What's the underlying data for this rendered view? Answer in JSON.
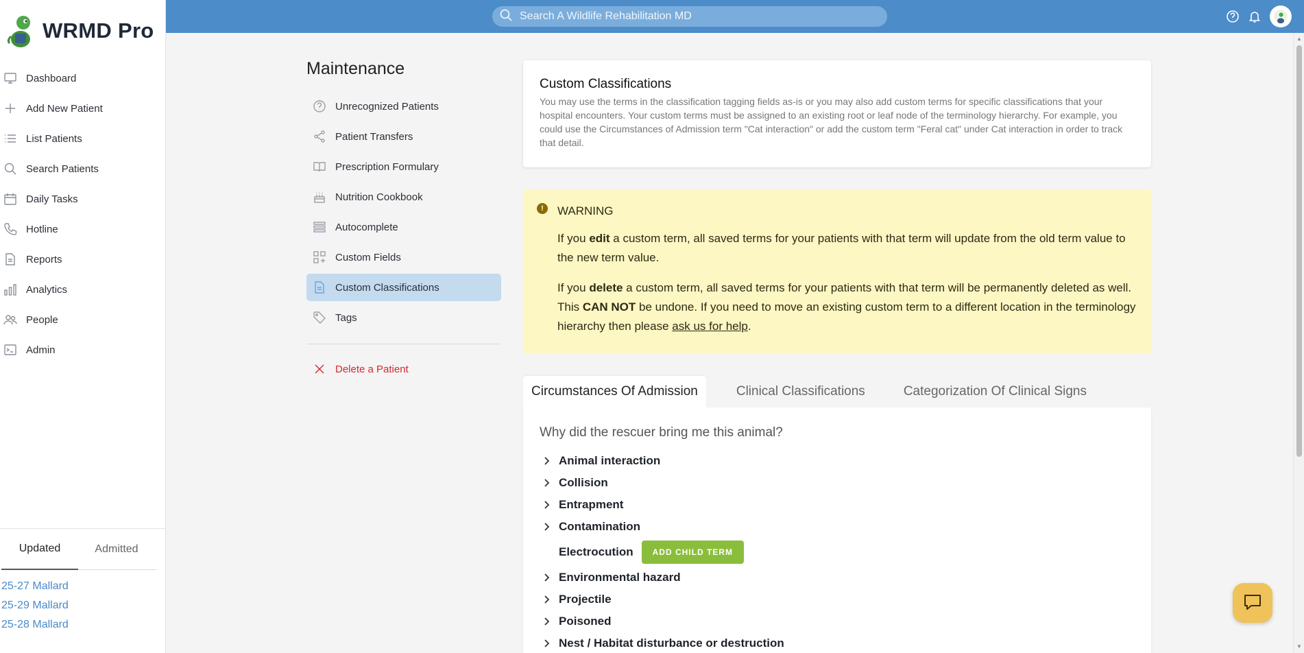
{
  "app": {
    "title": "WRMD Pro"
  },
  "nav": [
    {
      "label": "Dashboard",
      "icon": "monitor-icon"
    },
    {
      "label": "Add New Patient",
      "icon": "plus-icon"
    },
    {
      "label": "List Patients",
      "icon": "list-icon"
    },
    {
      "label": "Search Patients",
      "icon": "search-icon"
    },
    {
      "label": "Daily Tasks",
      "icon": "calendar-icon"
    },
    {
      "label": "Hotline",
      "icon": "phone-icon"
    },
    {
      "label": "Reports",
      "icon": "document-icon"
    },
    {
      "label": "Analytics",
      "icon": "bar-chart-icon"
    },
    {
      "label": "People",
      "icon": "people-icon"
    },
    {
      "label": "Admin",
      "icon": "terminal-icon"
    }
  ],
  "recent": {
    "tabs": [
      "Updated",
      "Admitted"
    ],
    "active_tab": "Updated",
    "items": [
      "25-27 Mallard",
      "25-29 Mallard",
      "25-28 Mallard"
    ]
  },
  "topbar": {
    "search_placeholder": "Search A Wildlife Rehabilitation MD",
    "icons": [
      "help-icon",
      "bell-icon",
      "user-avatar"
    ]
  },
  "maintenance": {
    "title": "Maintenance",
    "items": [
      {
        "label": "Unrecognized Patients",
        "icon": "question-icon"
      },
      {
        "label": "Patient Transfers",
        "icon": "share-icon"
      },
      {
        "label": "Prescription Formulary",
        "icon": "book-icon"
      },
      {
        "label": "Nutrition Cookbook",
        "icon": "cake-icon"
      },
      {
        "label": "Autocomplete",
        "icon": "stack-icon"
      },
      {
        "label": "Custom Fields",
        "icon": "grid-plus-icon"
      },
      {
        "label": "Custom Classifications",
        "icon": "file-icon",
        "active": true
      },
      {
        "label": "Tags",
        "icon": "tag-icon"
      }
    ],
    "danger_item": {
      "label": "Delete a Patient",
      "icon": "x-icon"
    }
  },
  "intro": {
    "title": "Custom Classifications",
    "body": "You may use the terms in the classification tagging fields as-is or you may also add custom terms for specific classifications that your hospital encounters. Your custom terms must be assigned to an existing root or leaf node of the terminology hierarchy. For example, you could use the Circumstances of Admission term \"Cat interaction\" or add the custom term \"Feral cat\" under Cat interaction in order to track that detail."
  },
  "warning": {
    "title": "WARNING",
    "p1_pre": "If you ",
    "p1_bold": "edit",
    "p1_post": " a custom term, all saved terms for your patients with that term will update from the old term value to the new term value.",
    "p2_pre": "If you ",
    "p2_bold": "delete",
    "p2_mid": " a custom term, all saved terms for your patients with that term will be permanently deleted as well. This ",
    "p2_bold2": "CAN NOT",
    "p2_post": " be undone. If you need to move an existing custom term to a different location in the terminology hierarchy then please ",
    "p2_link": "ask us for help",
    "p2_end": "."
  },
  "tabs": {
    "items": [
      "Circumstances Of Admission",
      "Clinical Classifications",
      "Categorization Of Clinical Signs"
    ],
    "active": 0
  },
  "tree": {
    "question": "Why did the rescuer bring me this animal?",
    "nodes": [
      {
        "label": "Animal interaction",
        "expandable": true
      },
      {
        "label": "Collision",
        "expandable": true
      },
      {
        "label": "Entrapment",
        "expandable": true
      },
      {
        "label": "Contamination",
        "expandable": true
      },
      {
        "label": "Electrocution",
        "expandable": false,
        "action": "ADD CHILD TERM"
      },
      {
        "label": "Environmental hazard",
        "expandable": true
      },
      {
        "label": "Projectile",
        "expandable": true
      },
      {
        "label": "Poisoned",
        "expandable": true
      },
      {
        "label": "Nest / Habitat disturbance or destruction",
        "expandable": true
      }
    ]
  },
  "colors": {
    "topbar": "#4c8cc8",
    "active_item": "#c3daef",
    "warning_bg": "#fdf7c3",
    "green_button": "#8bbd3c",
    "danger": "#d8262f",
    "link": "#4a8ac8",
    "chat_button": "#f0c25a"
  }
}
